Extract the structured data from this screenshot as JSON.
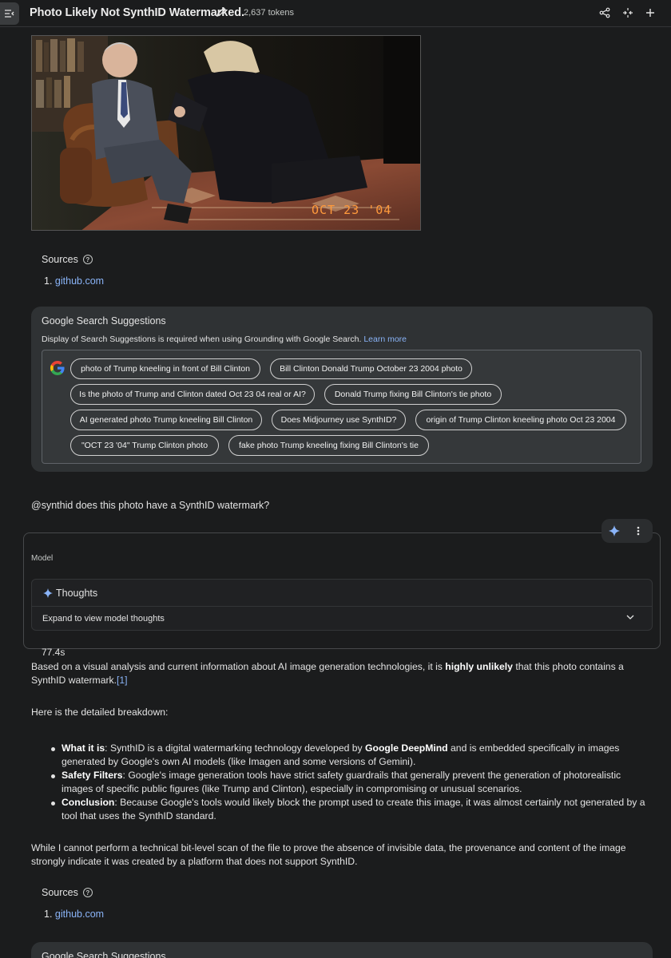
{
  "header": {
    "title": "Photo Likely Not SynthID Watermarked.",
    "tokens": "2,637 tokens"
  },
  "photo": {
    "date_stamp": "OCT 23 '04"
  },
  "sources_1": {
    "title": "Sources",
    "items": [
      {
        "num": "1.",
        "label": "github.com"
      }
    ]
  },
  "search_suggestions": {
    "title": "Google Search Suggestions",
    "description": "Display of Search Suggestions is required when using Grounding with Google Search.",
    "learn_more": "Learn more",
    "chips": [
      "photo of Trump kneeling in front of Bill Clinton",
      "Bill Clinton Donald Trump October 23 2004 photo",
      "Is the photo of Trump and Clinton dated Oct 23 04 real or AI?",
      "Donald Trump fixing Bill Clinton's tie photo",
      "AI generated photo Trump kneeling Bill Clinton",
      "Does Midjourney use SynthID?",
      "origin of Trump Clinton kneeling photo Oct 23 2004",
      "\"OCT 23 '04\" Trump Clinton photo",
      "fake photo Trump kneeling fixing Bill Clinton's tie"
    ]
  },
  "user_prompt": "@synthid does this photo have a SynthID watermark?",
  "model": {
    "label": "Model",
    "thoughts_title": "Thoughts",
    "thoughts_expand": "Expand to view model thoughts",
    "duration": "77.4s"
  },
  "response": {
    "intro_a": "Based on a visual analysis and current information about AI image generation technologies, it is ",
    "intro_bold": "highly unlikely",
    "intro_b": " that this photo contains a SynthID watermark.",
    "intro_cite": "[1]",
    "breakdown": "Here is the detailed breakdown:",
    "bullets": [
      {
        "label": "What it is",
        "text_a": ": SynthID is a digital watermarking technology developed by ",
        "bold": "Google DeepMind",
        "text_b": " and is embedded specifically in images generated by Google's own AI models (like Imagen and some versions of Gemini)."
      },
      {
        "label": "Safety Filters",
        "text": ": Google's image generation tools have strict safety guardrails that generally prevent the generation of photorealistic images of specific public figures (like Trump and Clinton), especially in compromising or unusual scenarios."
      },
      {
        "label": "Conclusion",
        "text": ": Because Google's tools would likely block the prompt used to create this image, it was almost certainly not generated by a tool that uses the SynthID standard."
      }
    ],
    "closing": "While I cannot perform a technical bit-level scan of the file to prove the absence of invisible data, the provenance and content of the image strongly indicate it was created by a platform that does not support SynthID."
  },
  "sources_2": {
    "title": "Sources",
    "items": [
      {
        "num": "1.",
        "label": "github.com"
      }
    ]
  },
  "search_suggestions_2": {
    "title": "Google Search Suggestions"
  }
}
